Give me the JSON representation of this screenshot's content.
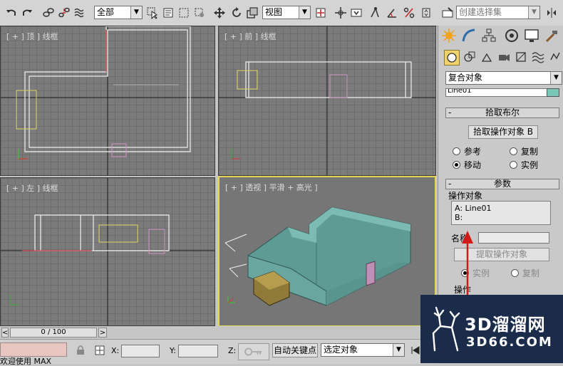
{
  "toolbar": {
    "selection_filter": "全部",
    "coord_system": "视图",
    "named_selection_placeholder": "创建选择集"
  },
  "viewports": {
    "top": "[ + ] 顶 ] 线框",
    "front": "[ + ] 前 ] 线框",
    "left": "[ + ] 左 ] 线框",
    "perspective": "[ + ] 透视 ] 平滑 + 高光 ]"
  },
  "command_panel": {
    "object_category": "复合对象",
    "object_name": "Line01",
    "pick_boolean": {
      "title": "拾取布尔",
      "pick_button": "拾取操作对象 B",
      "options": [
        "参考",
        "复制",
        "移动",
        "实例"
      ],
      "selected": "移动"
    },
    "parameters": {
      "title": "参数",
      "operands_group": "操作对象",
      "operand_a": "A: Line01",
      "operand_b": "B:",
      "name_label": "名称:",
      "name_value": "",
      "extract_button": "提取操作对象",
      "extract_options": [
        "实例",
        "复制"
      ],
      "extract_selected": "实例",
      "operation_group": "操作"
    }
  },
  "timeline": {
    "frame": "0 / 100",
    "prev": "<",
    "next": ">"
  },
  "status": {
    "welcome": "欢迎使用 MAX",
    "x_label": "X:",
    "y_label": "Y:",
    "z_label": "Z:",
    "x_value": "",
    "y_value": "",
    "auto_key": "自动关键点",
    "set_key_filter": "选定对象"
  },
  "watermark": {
    "brand": "3D溜溜网",
    "url": "3D66.COM"
  },
  "colors": {
    "active_viewport_border": "#e3d65a",
    "wall_color": "#6aa6a0",
    "annotation_arrow": "#d11a1a",
    "watermark_bg": "#1b2c4a"
  }
}
